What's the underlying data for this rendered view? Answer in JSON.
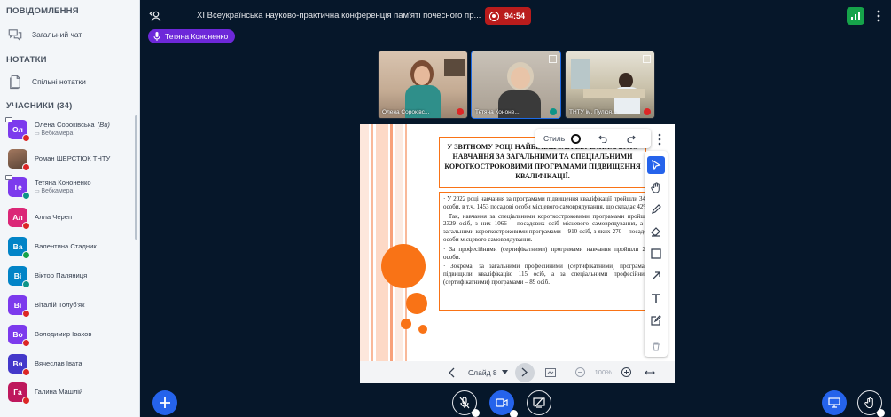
{
  "sidebar": {
    "messages_title": "ПОВІДОМЛЕННЯ",
    "public_chat": "Загальний чат",
    "notes_title": "НОТАТКИ",
    "shared_notes": "Спільні нотатки",
    "users_title": "УЧАСНИКИ (34)",
    "users": [
      {
        "initials": "Ол",
        "name": "Олена Сороківська",
        "you": "(Ви)",
        "sub": "Вебкамера",
        "color": "#7c3aed",
        "status": "#dc2626",
        "moderator": true
      },
      {
        "initials": "",
        "name": "Роман ШЕРСТЮК ТНТУ",
        "sub": "",
        "color": "#9ca3af",
        "status": "#dc2626",
        "photo": true
      },
      {
        "initials": "Те",
        "name": "Тетяна Кононенко",
        "sub": "Вебкамера",
        "color": "#7c3aed",
        "status": "#0d9488",
        "moderator": true
      },
      {
        "initials": "Ал",
        "name": "Алла Череп",
        "sub": "",
        "color": "#db2777",
        "status": "#dc2626"
      },
      {
        "initials": "Ва",
        "name": "Валентина Стадник",
        "sub": "",
        "color": "#0284c7",
        "status": "#16a34a"
      },
      {
        "initials": "Ві",
        "name": "Віктор Паляниця",
        "sub": "",
        "color": "#0284c7",
        "status": "#0d9488"
      },
      {
        "initials": "Ві",
        "name": "Віталій Толуб'як",
        "sub": "",
        "color": "#7c3aed",
        "status": "#dc2626"
      },
      {
        "initials": "Во",
        "name": "Володимир Івахов",
        "sub": "",
        "color": "#7c3aed",
        "status": "#dc2626"
      },
      {
        "initials": "Вя",
        "name": "Вячеслав Івата",
        "sub": "",
        "color": "#4338ca",
        "status": "#dc2626"
      },
      {
        "initials": "Га",
        "name": "Галина Машлій",
        "sub": "",
        "color": "#be185d",
        "status": "#dc2626"
      }
    ]
  },
  "topbar": {
    "title": "XI Всеукраїнська науково-практична конференція пам'яті почесного пр...",
    "timer": "94:54",
    "talker": "Тетяна Кононенко"
  },
  "videos": [
    {
      "name": "Олена Сороківс...",
      "bg": "#c8a58a"
    },
    {
      "name": "Тетяна Кононе...",
      "bg": "#b9b0a3"
    },
    {
      "name": "ТНТУ ім. Пулюя...",
      "bg": "#aab3a0"
    }
  ],
  "slide": {
    "title": "У ЗВІТНОМУ РОЦІ НАЙБІЛЬШ ЗАТРЕБУВАНИМ БУЛО НАВЧАННЯ ЗА ЗАГАЛЬНИМИ ТА СПЕЦІАЛЬНИМИ КОРОТКОСТРОКОВИМИ ПРОГРАМАМИ ПІДВИЩЕННЯ КВАЛІФІКАЦІЇ.",
    "paragraphs": [
      "· У 2022 році навчання за програмами підвищення кваліфікації пройшли 3443 особи, в т.ч. 1453 посадові особи місцевого самоврядування, що складає 42%.",
      "· Так, навчання за спеціальними короткостроковими програмами пройшли 2329 осіб, з них 1066 – посадових осіб місцевого самоврядування, а за загальними короткостроковими програмами – 910 осіб, з яких 270 – посадові особи місцевого самоврядування.",
      "· За професійними (сертифікатними) програмами навчання пройшли 204 особи.",
      "· Зокрема, за загальними професійними (сертифікатними) програмами підвищили кваліфікацію 115 осіб, а за спеціальними професійними (сертифікатними) програмами – 89 осіб."
    ]
  },
  "tools": {
    "style_label": "Стиль"
  },
  "slide_nav": {
    "slide_label": "Слайд 8",
    "zoom": "100%"
  },
  "colors": {
    "accent": "#2563eb",
    "record": "#b91c1c",
    "orange": "#f97316"
  }
}
